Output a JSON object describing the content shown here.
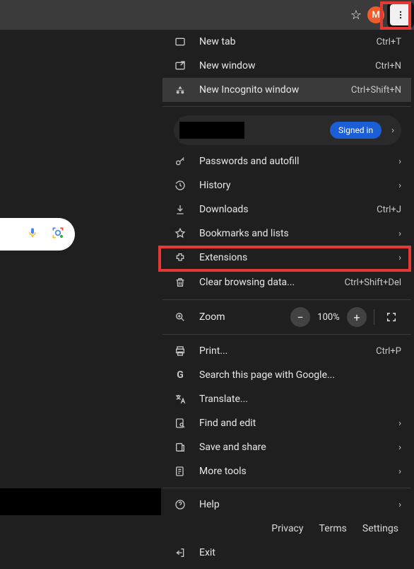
{
  "toolbar": {
    "avatar_letter": "M"
  },
  "profile": {
    "signed_in_label": "Signed in"
  },
  "menu": {
    "new_tab": {
      "label": "New tab",
      "shortcut": "Ctrl+T"
    },
    "new_window": {
      "label": "New window",
      "shortcut": "Ctrl+N"
    },
    "new_incognito": {
      "label": "New Incognito window",
      "shortcut": "Ctrl+Shift+N"
    },
    "passwords": {
      "label": "Passwords and autofill"
    },
    "history": {
      "label": "History"
    },
    "downloads": {
      "label": "Downloads",
      "shortcut": "Ctrl+J"
    },
    "bookmarks": {
      "label": "Bookmarks and lists"
    },
    "extensions": {
      "label": "Extensions"
    },
    "clear_data": {
      "label": "Clear browsing data...",
      "shortcut": "Ctrl+Shift+Del"
    },
    "zoom": {
      "label": "Zoom",
      "value": "100%"
    },
    "print": {
      "label": "Print...",
      "shortcut": "Ctrl+P"
    },
    "search_google": {
      "label": "Search this page with Google..."
    },
    "translate": {
      "label": "Translate..."
    },
    "find_edit": {
      "label": "Find and edit"
    },
    "save_share": {
      "label": "Save and share"
    },
    "more_tools": {
      "label": "More tools"
    },
    "help": {
      "label": "Help"
    },
    "settings": {
      "label": "Settings"
    },
    "exit": {
      "label": "Exit"
    }
  },
  "footer": {
    "privacy": "Privacy",
    "terms": "Terms",
    "settings": "Settings"
  }
}
